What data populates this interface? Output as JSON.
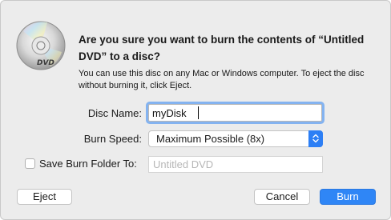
{
  "dialog": {
    "icon": "dvd-disc-icon",
    "headline": "Are you sure you want to burn the contents of “Untitled DVD” to a disc?",
    "info": "You can use this disc on any Mac or Windows computer. To eject the disc without burning it, click Eject."
  },
  "form": {
    "disc_name_label": "Disc Name:",
    "disc_name_value": "myDisk",
    "burn_speed_label": "Burn Speed:",
    "burn_speed_value": "Maximum Possible (8x)",
    "save_folder_label": "Save Burn Folder To:",
    "save_folder_checked": false,
    "save_folder_placeholder": "Untitled DVD"
  },
  "buttons": {
    "eject": "Eject",
    "cancel": "Cancel",
    "burn": "Burn"
  },
  "colors": {
    "accent": "#2f86f6",
    "focus_ring": "#84b3f0",
    "dialog_bg": "#ececec"
  }
}
